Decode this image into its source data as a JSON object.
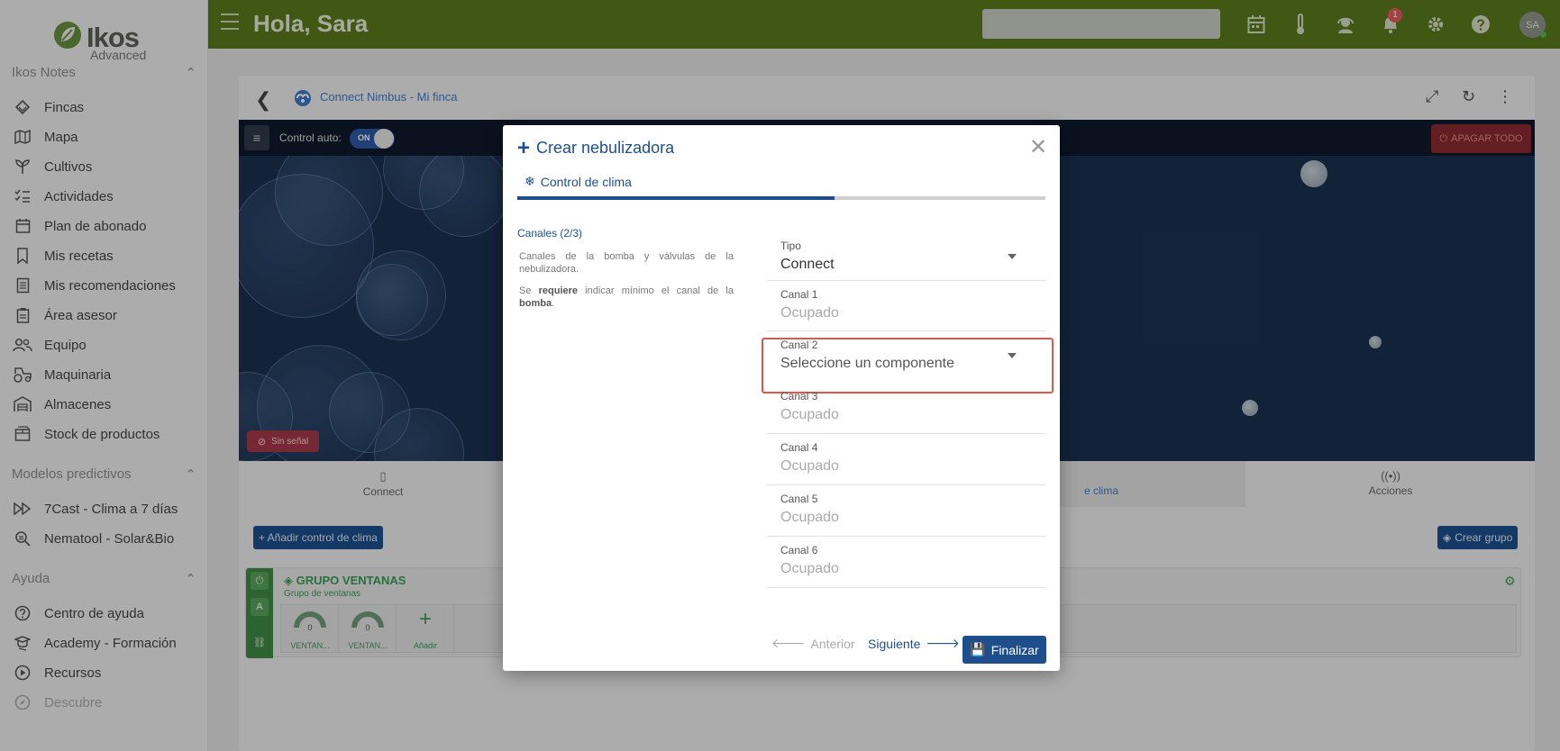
{
  "app": {
    "logo_word": "Ikos",
    "logo_sub": "Advanced",
    "greeting": "Hola, Sara",
    "notifications_count": "1",
    "avatar_initials": "SA"
  },
  "sidebar": {
    "section1_title": "Ikos Notes",
    "section1_items": [
      {
        "label": "Fincas",
        "icon": "layers-icon"
      },
      {
        "label": "Mapa",
        "icon": "map-icon"
      },
      {
        "label": "Cultivos",
        "icon": "sprout-icon"
      },
      {
        "label": "Actividades",
        "icon": "checklist-icon"
      },
      {
        "label": "Plan de abonado",
        "icon": "calendar-icon"
      },
      {
        "label": "Mis recetas",
        "icon": "bookmark-icon"
      },
      {
        "label": "Mis recomendaciones",
        "icon": "document-icon"
      },
      {
        "label": "Área asesor",
        "icon": "clipboard-icon"
      },
      {
        "label": "Equipo",
        "icon": "team-icon"
      },
      {
        "label": "Maquinaria",
        "icon": "tractor-icon"
      },
      {
        "label": "Almacenes",
        "icon": "warehouse-icon"
      },
      {
        "label": "Stock de productos",
        "icon": "box-icon"
      }
    ],
    "section2_title": "Modelos predictivos",
    "section2_items": [
      {
        "label": "7Cast - Clima a 7 días",
        "icon": "forward-icon"
      },
      {
        "label": "Nematool - Solar&Bio",
        "icon": "bug-search-icon"
      }
    ],
    "section3_title": "Ayuda",
    "section3_items": [
      {
        "label": "Centro de ayuda",
        "icon": "help-circle-icon"
      },
      {
        "label": "Academy - Formación",
        "icon": "graduation-icon"
      },
      {
        "label": "Recursos",
        "icon": "play-icon"
      },
      {
        "label": "Descubre",
        "icon": "compass-icon"
      }
    ]
  },
  "panel": {
    "breadcrumb": "Connect Nimbus - Mi finca",
    "control_auto_label": "Control auto:",
    "toggle_label": "ON",
    "apagar_label": "APAGAR TODO",
    "sin_senal": "Sin señal",
    "tabs": [
      {
        "label": "Connect"
      },
      {
        "label": "e clima"
      },
      {
        "label": "Acciones"
      }
    ],
    "add_climate_button": "+ Añadir control de clima",
    "create_group_button": "Crear grupo",
    "group": {
      "title": "GRUPO VENTANAS",
      "subtitle": "Grupo de ventanas",
      "strip_auto": "A",
      "gauges": [
        {
          "value": "0",
          "label": "VENTAN..."
        },
        {
          "value": "0",
          "label": "VENTAN..."
        }
      ],
      "add_label": "Añadir"
    }
  },
  "modal": {
    "title": "Crear nebulizadora",
    "step_label": "Control de clima",
    "progress_fraction": 0.6,
    "section_title": "Canales (2/3)",
    "description1": "Canales de la bomba y válvulas de la nebulizadora.",
    "description2_pre": "Se ",
    "description2_bold": "requiere",
    "description2_mid": " indicar mínimo el canal de la ",
    "description2_bold2": "bomba",
    "description2_end": ".",
    "fields": [
      {
        "label": "Tipo",
        "value": "Connect"
      },
      {
        "label": "Canal 1",
        "value": "Ocupado"
      },
      {
        "label": "Canal 2",
        "value": "Seleccione un componente"
      },
      {
        "label": "Canal 3",
        "value": "Ocupado"
      },
      {
        "label": "Canal 4",
        "value": "Ocupado"
      },
      {
        "label": "Canal 5",
        "value": "Ocupado"
      },
      {
        "label": "Canal 6",
        "value": "Ocupado"
      }
    ],
    "prev_label": "Anterior",
    "next_label": "Siguiente",
    "finish_label": "Finalizar"
  },
  "colors": {
    "topbar": "#5a7b1d",
    "primary": "#1e4f8c",
    "highlight": "#e0574a",
    "group_green": "#3a9a55"
  }
}
